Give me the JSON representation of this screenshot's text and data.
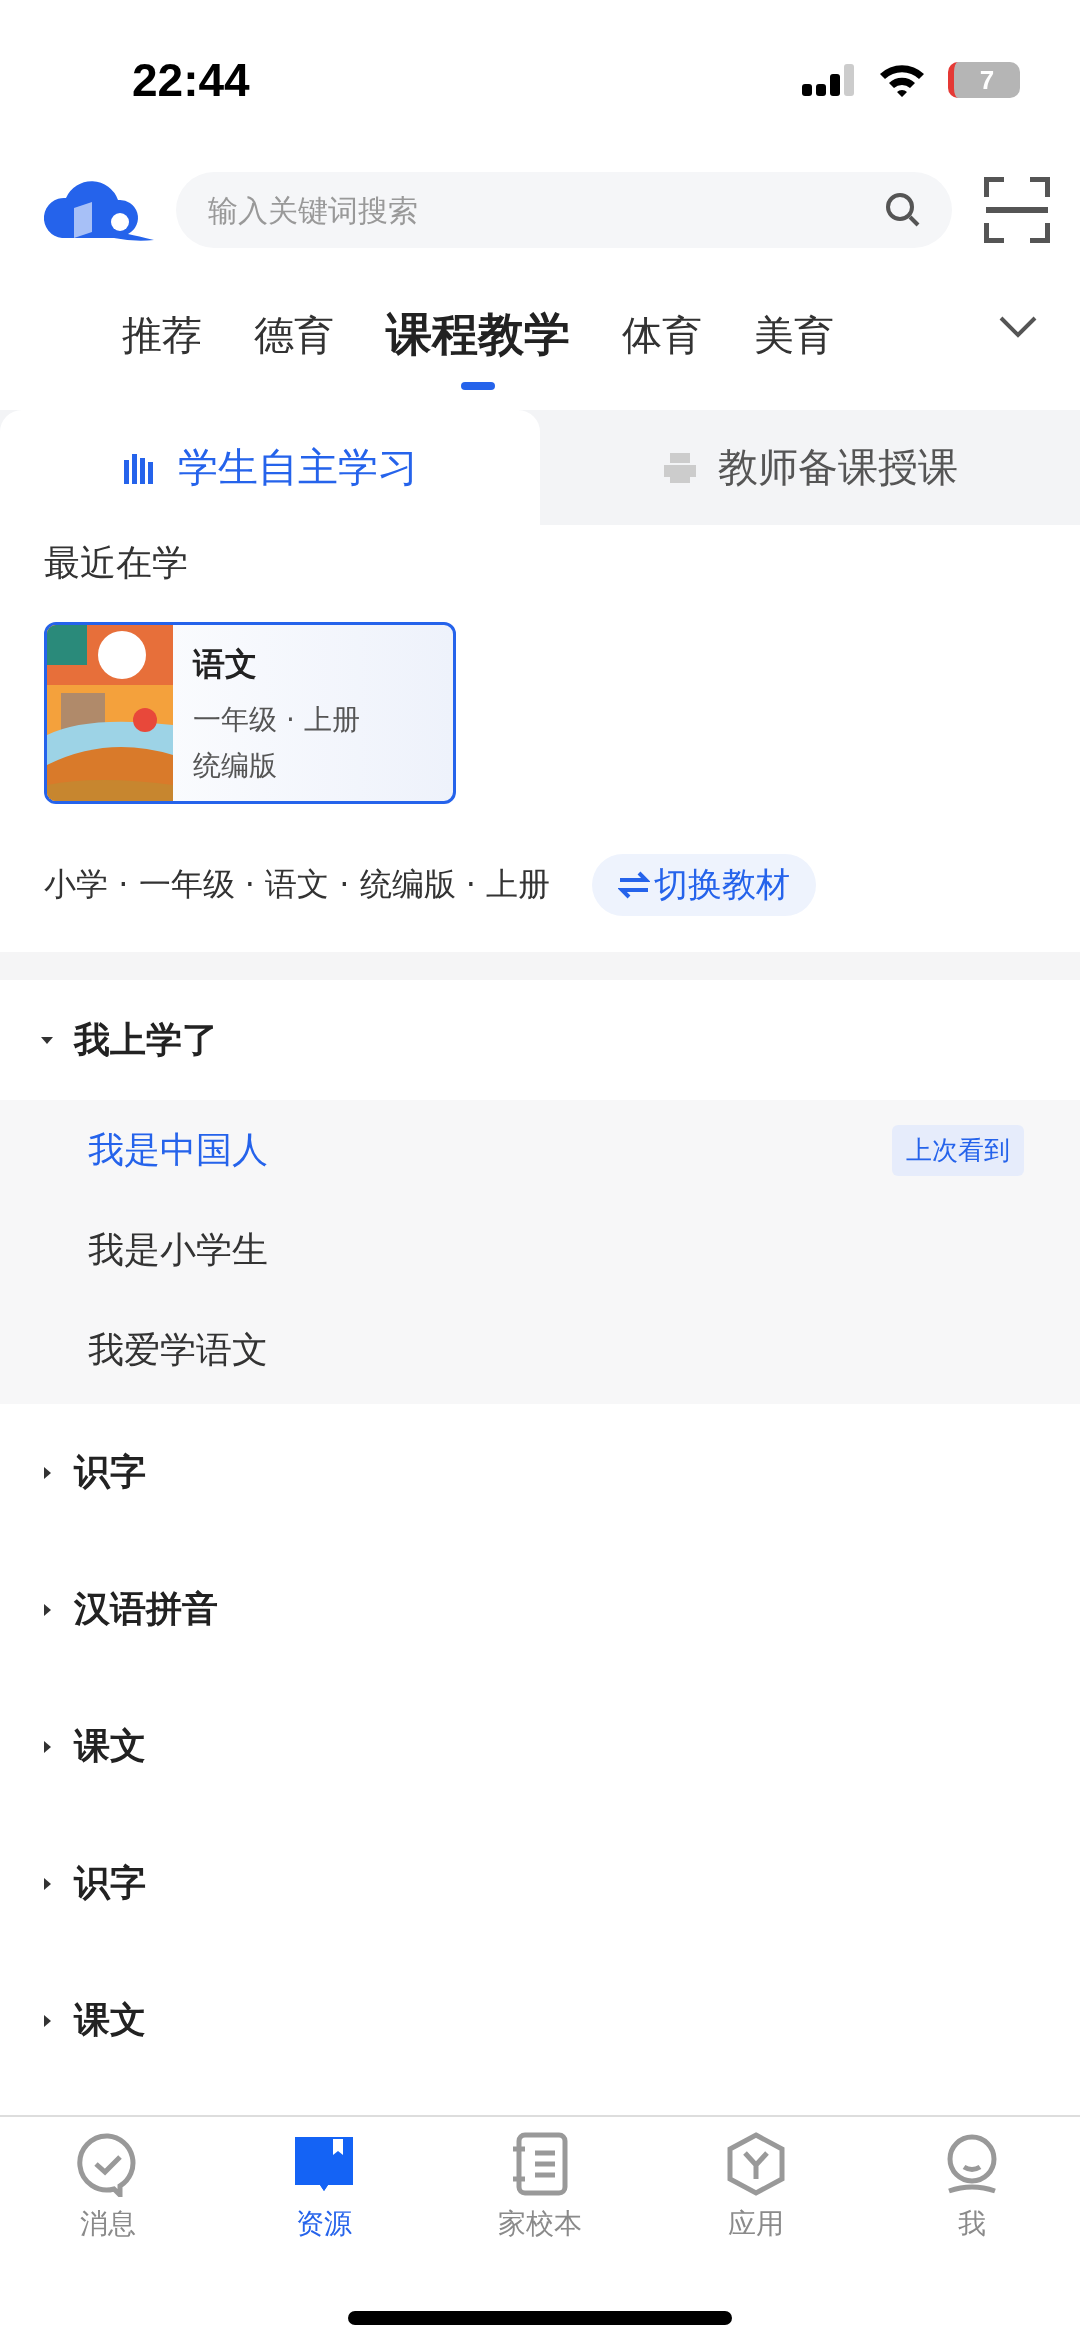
{
  "status_bar": {
    "time": "22:44",
    "battery": "7"
  },
  "search": {
    "placeholder": "输入关键词搜索"
  },
  "categories": [
    {
      "label": "推荐",
      "selected": false
    },
    {
      "label": "德育",
      "selected": false
    },
    {
      "label": "课程教学",
      "selected": true
    },
    {
      "label": "体育",
      "selected": false
    },
    {
      "label": "美育",
      "selected": false
    }
  ],
  "mode_tabs": [
    {
      "label": "学生自主学习",
      "selected": true
    },
    {
      "label": "教师备课授课",
      "selected": false
    }
  ],
  "recent": {
    "title": "最近在学",
    "book": {
      "subject": "语文",
      "grade": "一年级 · 上册",
      "edition": "统编版"
    }
  },
  "breadcrumb": "小学 · 一年级 · 语文 · 统编版 · 上册",
  "switch_button": "切换教材",
  "units": [
    {
      "title": "我上学了",
      "expanded": true,
      "lessons": [
        {
          "title": "我是中国人",
          "selected": true,
          "badge": "上次看到"
        },
        {
          "title": "我是小学生",
          "selected": false
        },
        {
          "title": "我爱学语文",
          "selected": false
        }
      ]
    },
    {
      "title": "识字",
      "expanded": false
    },
    {
      "title": "汉语拼音",
      "expanded": false
    },
    {
      "title": "课文",
      "expanded": false
    },
    {
      "title": "识字",
      "expanded": false
    },
    {
      "title": "课文",
      "expanded": false
    }
  ],
  "bottom_nav": [
    {
      "label": "消息",
      "selected": false
    },
    {
      "label": "资源",
      "selected": true
    },
    {
      "label": "家校本",
      "selected": false
    },
    {
      "label": "应用",
      "selected": false
    },
    {
      "label": "我",
      "selected": false
    }
  ]
}
